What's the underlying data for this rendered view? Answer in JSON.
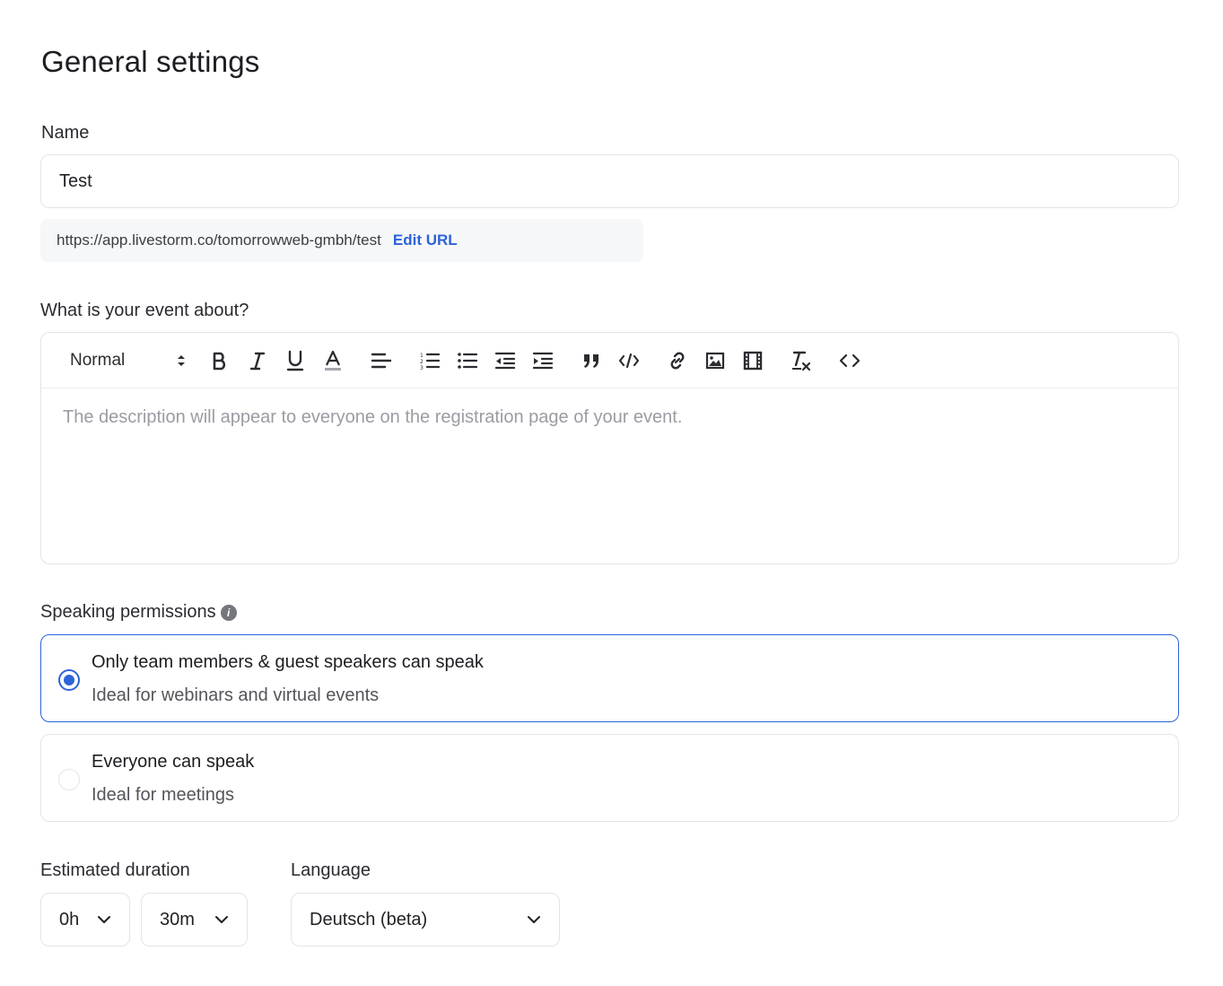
{
  "page": {
    "title": "General settings"
  },
  "name": {
    "label": "Name",
    "value": "Test"
  },
  "url": {
    "text": "https://app.livestorm.co/tomorrowweb-gmbh/test",
    "edit_label": "Edit URL"
  },
  "description": {
    "label": "What is your event about?",
    "format": "Normal",
    "placeholder": "The description will appear to everyone on the registration page of your event."
  },
  "speaking": {
    "label": "Speaking permissions",
    "options": [
      {
        "title": "Only team members & guest speakers can speak",
        "desc": "Ideal for webinars and virtual events",
        "selected": true
      },
      {
        "title": "Everyone can speak",
        "desc": "Ideal for meetings",
        "selected": false
      }
    ]
  },
  "duration": {
    "label": "Estimated duration",
    "hours": "0h",
    "minutes": "30m"
  },
  "language": {
    "label": "Language",
    "value": "Deutsch (beta)"
  },
  "colors": {
    "accent": "#2d63d8",
    "border": "#e3e4e8",
    "url_bg": "#f6f7f9"
  }
}
